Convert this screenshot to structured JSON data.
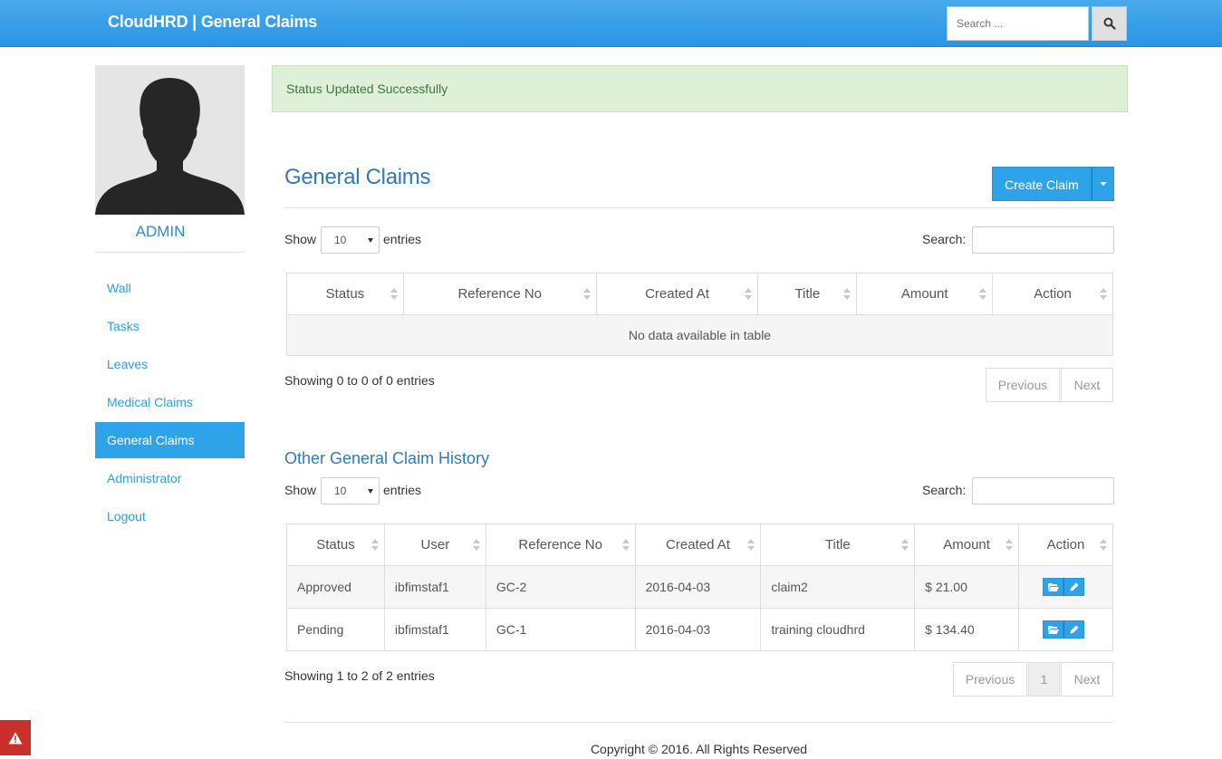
{
  "header": {
    "brand": "CloudHRD | General Claims",
    "search_placeholder": "Search ...",
    "search_icon": "search-icon"
  },
  "sidebar": {
    "profile_name": "ADMIN",
    "items": [
      {
        "label": "Wall",
        "active": false
      },
      {
        "label": "Tasks",
        "active": false
      },
      {
        "label": "Leaves",
        "active": false
      },
      {
        "label": "Medical Claims",
        "active": false
      },
      {
        "label": "General Claims",
        "active": true
      },
      {
        "label": "Administrator",
        "active": false
      },
      {
        "label": "Logout",
        "active": false
      }
    ]
  },
  "alert": {
    "message": "Status Updated Successfully"
  },
  "main": {
    "title": "General Claims",
    "create_label": "Create Claim",
    "my_claims": {
      "show_label": "Show",
      "entries_label": "entries",
      "page_length": "10",
      "search_label": "Search:",
      "columns": [
        "Status",
        "Reference No",
        "Created At",
        "Title",
        "Amount",
        "Action"
      ],
      "empty_message": "No data available in table",
      "info": "Showing 0 to 0 of 0 entries",
      "prev_label": "Previous",
      "next_label": "Next"
    },
    "history": {
      "title": "Other General Claim History",
      "show_label": "Show",
      "entries_label": "entries",
      "page_length": "10",
      "search_label": "Search:",
      "columns": [
        "Status",
        "User",
        "Reference No",
        "Created At",
        "Title",
        "Amount",
        "Action"
      ],
      "rows": [
        {
          "status": "Approved",
          "user": "ibfimstaf1",
          "ref": "GC-2",
          "created": "2016-04-03",
          "title": "claim2",
          "amount": "$ 21.00"
        },
        {
          "status": "Pending",
          "user": "ibfimstaf1",
          "ref": "GC-1",
          "created": "2016-04-03",
          "title": "training cloudhrd",
          "amount": "$ 134.40"
        }
      ],
      "info": "Showing 1 to 2 of 2 entries",
      "prev_label": "Previous",
      "page": "1",
      "next_label": "Next"
    }
  },
  "footer": {
    "copyright": "Copyright © 2016. All Rights Reserved"
  },
  "colors": {
    "primary": "#2fa3ea",
    "heading": "#2f7ab8",
    "alert_bg": "#dff0d8",
    "alert_text": "#3c763d",
    "danger": "#c9302c"
  }
}
